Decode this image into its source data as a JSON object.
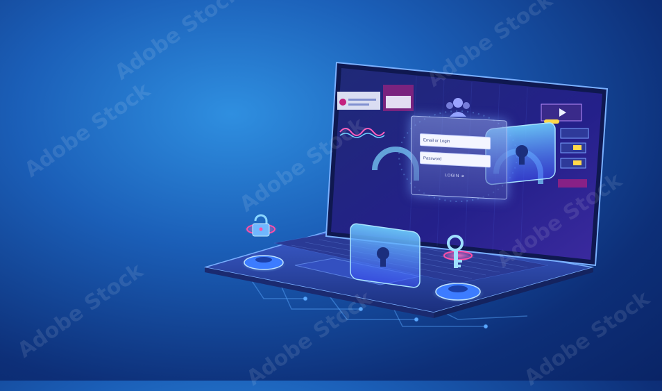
{
  "watermark": {
    "text": "Adobe Stock"
  },
  "login": {
    "email_placeholder": "Email or Login",
    "password_placeholder": "Password",
    "button_label": "LOGIN"
  },
  "colors": {
    "accent_glow": "#6fb7ff",
    "lock_pink": "#ff4fa7",
    "keyboard": "#2f3f9a",
    "gear": "#3c7cff"
  },
  "icons": [
    "padlock-icon",
    "key-icon",
    "gear-icon",
    "user-group-icon",
    "play-icon"
  ]
}
